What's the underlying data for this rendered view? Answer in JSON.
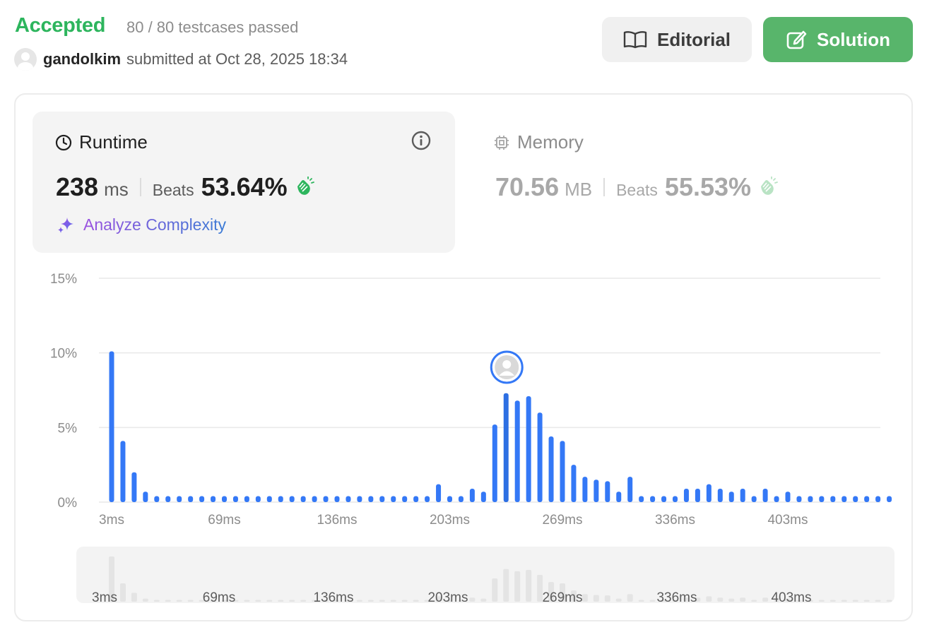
{
  "header": {
    "status": "Accepted",
    "testcases": "80 / 80 testcases passed",
    "username": "gandolkim",
    "submitted_text": "submitted at Oct 28, 2025 18:34"
  },
  "buttons": {
    "editorial": "Editorial",
    "solution": "Solution"
  },
  "runtime": {
    "title": "Runtime",
    "value": "238",
    "unit": "ms",
    "beats_label": "Beats",
    "beats": "53.64%",
    "analyze_label": "Analyze Complexity"
  },
  "memory": {
    "title": "Memory",
    "value": "70.56",
    "unit": "MB",
    "beats_label": "Beats",
    "beats": "55.53%"
  },
  "colors": {
    "accepted": "#2db55d",
    "bar": "#3478f6",
    "bar_highlight": "#2d6fe3",
    "solution_button": "#58b56b",
    "mini_bar": "#e4e4e4"
  },
  "chart_data": {
    "type": "bar",
    "ylabel_ticks": [
      "0%",
      "5%",
      "10%",
      "15%"
    ],
    "ylim": [
      0,
      15
    ],
    "x_tick_labels": [
      "3ms",
      "69ms",
      "136ms",
      "203ms",
      "269ms",
      "336ms",
      "403ms"
    ],
    "x_tick_indices": [
      0,
      10,
      20,
      30,
      40,
      50,
      60
    ],
    "highlight_index": 35,
    "grid": true,
    "values": [
      10.1,
      4.1,
      2.0,
      0.7,
      0.4,
      0.4,
      0.4,
      0.4,
      0.4,
      0.4,
      0.4,
      0.4,
      0.4,
      0.4,
      0.4,
      0.4,
      0.4,
      0.4,
      0.4,
      0.4,
      0.4,
      0.4,
      0.4,
      0.4,
      0.4,
      0.4,
      0.4,
      0.4,
      0.4,
      1.2,
      0.4,
      0.4,
      0.9,
      0.7,
      5.2,
      7.3,
      6.8,
      7.1,
      6.0,
      4.4,
      4.1,
      2.5,
      1.7,
      1.5,
      1.4,
      0.7,
      1.7,
      0.4,
      0.4,
      0.4,
      0.4,
      0.9,
      0.9,
      1.2,
      0.9,
      0.7,
      0.9,
      0.4,
      0.9,
      0.4,
      0.7,
      0.4,
      0.4,
      0.4,
      0.4,
      0.4,
      0.4,
      0.4,
      0.4,
      0.4
    ]
  }
}
